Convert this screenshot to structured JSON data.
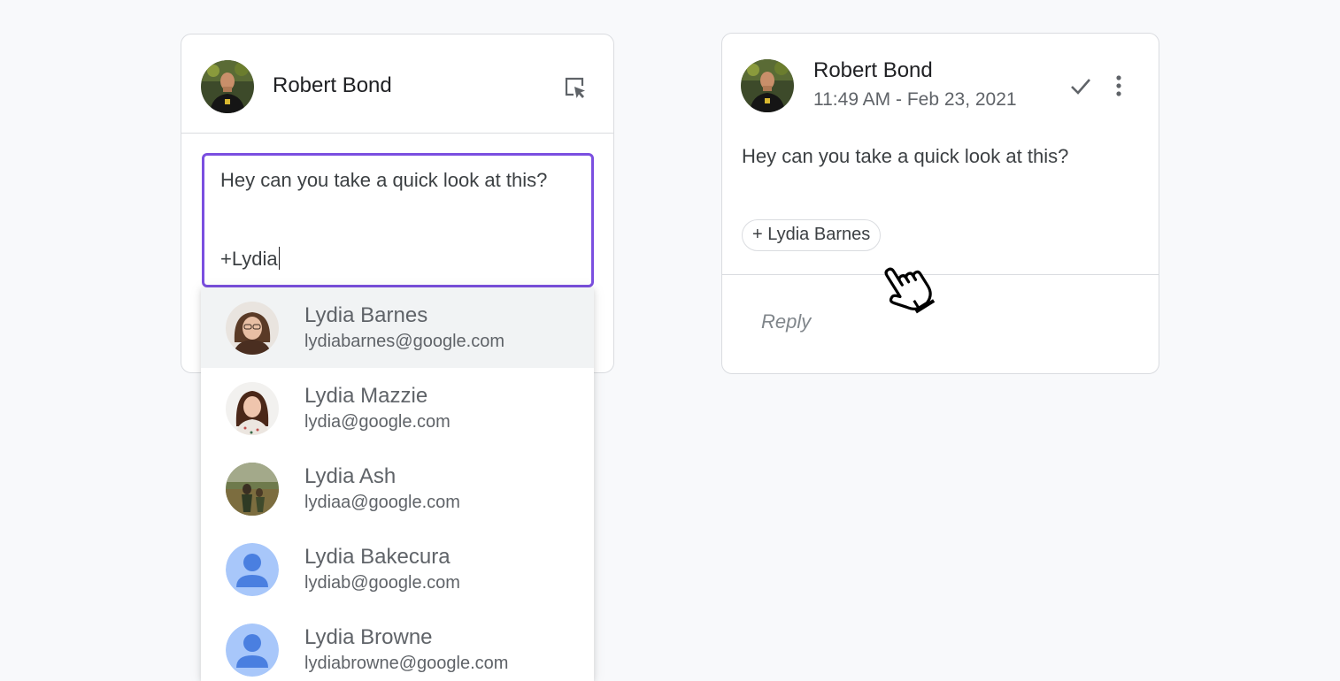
{
  "compose": {
    "author": "Robert Bond",
    "draft_line1": "Hey can you take a quick look at this?",
    "draft_line2": "+Lydia",
    "assign_icon": "assign-cursor-icon"
  },
  "suggestions": [
    {
      "name": "Lydia Barnes",
      "email": "lydiabarnes@google.com",
      "avatar": "photo",
      "active": true
    },
    {
      "name": "Lydia Mazzie",
      "email": "lydia@google.com",
      "avatar": "photo"
    },
    {
      "name": "Lydia Ash",
      "email": "lydiaa@google.com",
      "avatar": "photo"
    },
    {
      "name": "Lydia Bakecura",
      "email": "lydiab@google.com",
      "avatar": "default-person-icon"
    },
    {
      "name": "Lydia Browne",
      "email": "lydiabrowne@google.com",
      "avatar": "default-person-icon"
    }
  ],
  "comment": {
    "author": "Robert Bond",
    "timestamp": "11:49 AM - Feb 23, 2021",
    "text": "Hey can you take a quick look at this?",
    "mention": "+ Lydia Barnes",
    "reply_placeholder": "Reply",
    "icons": [
      "checkmark-icon",
      "more-vert-icon"
    ]
  },
  "colors": {
    "accent_border": "#7b4fe0",
    "background": "#f8f9fb",
    "default_avatar_bg": "#a8c7fa",
    "default_avatar_fg": "#4a7fe0"
  }
}
